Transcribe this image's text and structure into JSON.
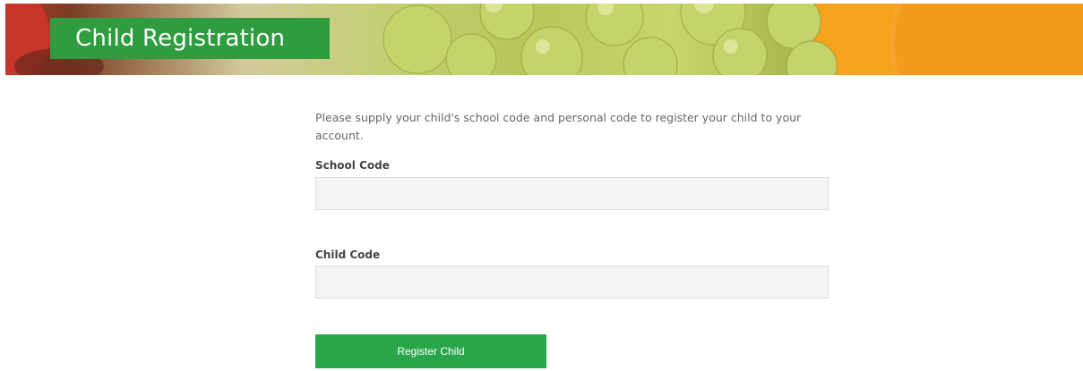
{
  "header": {
    "title": "Child Registration"
  },
  "form": {
    "intro": "Please supply your child's school code and personal code to register your child to your account.",
    "school_code": {
      "label": "School Code",
      "value": "",
      "placeholder": ""
    },
    "child_code": {
      "label": "Child Code",
      "value": "",
      "placeholder": ""
    },
    "submit_label": "Register Child"
  },
  "colors": {
    "brand_green": "#2f9d3f",
    "button_green": "#2aa64a",
    "input_bg": "#f4f4f4"
  }
}
